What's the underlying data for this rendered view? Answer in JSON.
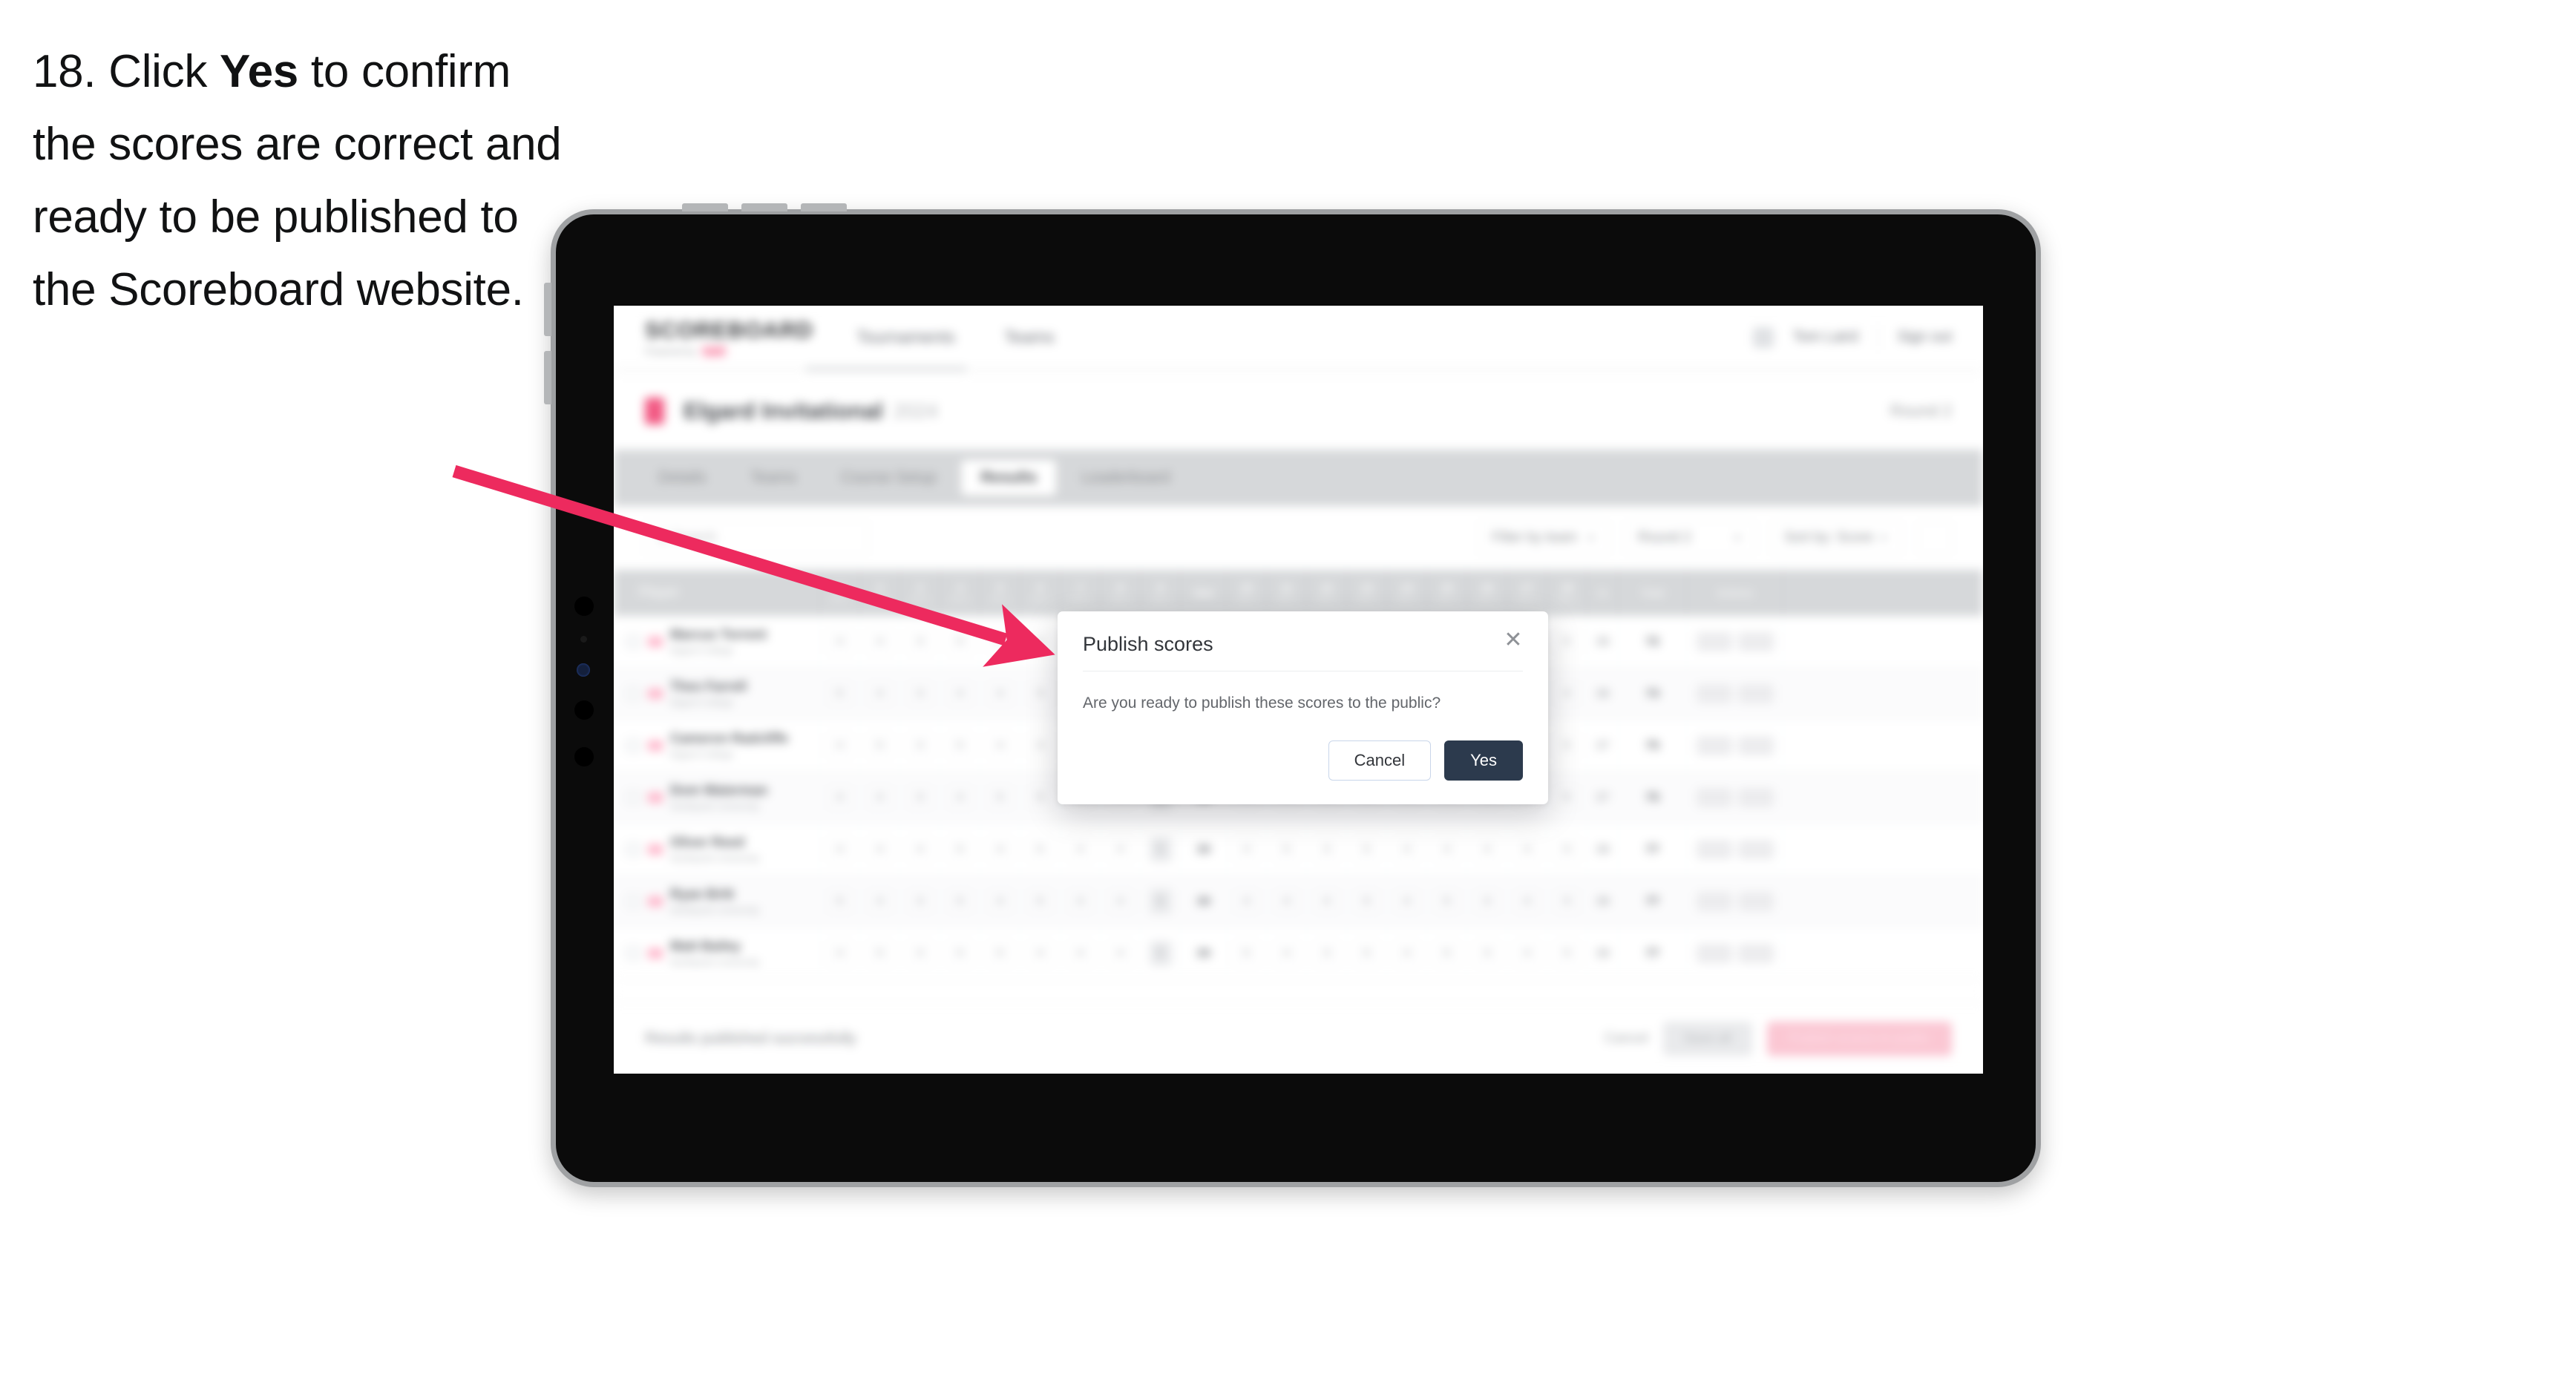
{
  "instruction": {
    "number": "18.",
    "before_bold": "Click ",
    "bold": "Yes",
    "after_bold": " to confirm the scores are correct and ready to be published to the Scoreboard website."
  },
  "colors": {
    "arrow": "#ED2A5E",
    "accent_pink": "#F0386B",
    "primary_dark": "#2C3A4D",
    "tab_bar": "#D6D8DA",
    "publish_button": "#FBC6D3"
  },
  "app": {
    "logo": {
      "main": "SCOREBOARD",
      "sub": "Powered by",
      "sub_accent": "Golf"
    },
    "nav": [
      {
        "label": "Tournaments"
      },
      {
        "label": "Teams"
      }
    ],
    "header_right": {
      "avatar_icon": "user-avatar-icon",
      "user": "Tom Laird",
      "signout": "Sign out"
    },
    "tournament": {
      "flag_icon": "tournament-flag-icon",
      "title": "Elgard Invitational",
      "subtitle": "2024",
      "right_label": "Round 2"
    },
    "tabs": [
      {
        "label": "Details",
        "active": false
      },
      {
        "label": "Teams",
        "active": false
      },
      {
        "label": "Course Setup",
        "active": false
      },
      {
        "label": "Results",
        "active": true
      },
      {
        "label": "Leaderboard",
        "active": false
      }
    ],
    "filters": {
      "search_placeholder": "Search",
      "search_icon": "search-icon",
      "selects": [
        {
          "label": "Filter by team",
          "caret_icon": "chevron-down-icon"
        },
        {
          "label": "Round 2",
          "caret_icon": "chevron-down-icon"
        },
        {
          "label": "Sort by: Score",
          "caret_icon": "chevron-down-icon"
        }
      ],
      "settings_icon": "columns-settings-icon"
    },
    "table": {
      "player_header": "Player",
      "holes": [
        {
          "n": "1",
          "par": "Par 4"
        },
        {
          "n": "2",
          "par": "Par 4"
        },
        {
          "n": "3",
          "par": "Par 3"
        },
        {
          "n": "4",
          "par": "Par 5"
        },
        {
          "n": "5",
          "par": "Par 4"
        },
        {
          "n": "6",
          "par": "Par 4"
        },
        {
          "n": "7",
          "par": "Par 3"
        },
        {
          "n": "8",
          "par": "Par 4"
        },
        {
          "n": "9",
          "par": "Par 5"
        }
      ],
      "out_label": "Out",
      "holes_back": [
        {
          "n": "10",
          "par": "Par 4"
        },
        {
          "n": "11",
          "par": "Par 4"
        },
        {
          "n": "12",
          "par": "Par 3"
        },
        {
          "n": "13",
          "par": "Par 5"
        },
        {
          "n": "14",
          "par": "Par 4"
        },
        {
          "n": "15",
          "par": "Par 4"
        },
        {
          "n": "16",
          "par": "Par 3"
        },
        {
          "n": "17",
          "par": "Par 4"
        },
        {
          "n": "18",
          "par": "Par 5"
        }
      ],
      "in_label": "In",
      "total_label": "Total",
      "action_label": "Actions",
      "rows": [
        {
          "name": "Marcus Torrent",
          "sub": "Elgard College",
          "front": [
            "4",
            "4",
            "3",
            "5",
            "4",
            "4",
            "3",
            "4",
            "5"
          ],
          "out": "36",
          "back": [
            "4",
            "4",
            "3",
            "5",
            "4",
            "4",
            "3",
            "4",
            "5"
          ],
          "in": "36",
          "total": "72"
        },
        {
          "name": "Theo Farrell",
          "sub": "Elgard College",
          "front": [
            "5",
            "4",
            "3",
            "4",
            "4",
            "5",
            "3",
            "4",
            "5"
          ],
          "out": "37",
          "back": [
            "4",
            "5",
            "3",
            "5",
            "4",
            "4",
            "3",
            "4",
            "4"
          ],
          "in": "36",
          "total": "73"
        },
        {
          "name": "Cameron Radcliffe",
          "sub": "Elgard College",
          "front": [
            "4",
            "5",
            "3",
            "5",
            "4",
            "4",
            "4",
            "4",
            "5"
          ],
          "out": "38",
          "back": [
            "4",
            "4",
            "3",
            "5",
            "5",
            "4",
            "3",
            "4",
            "5"
          ],
          "in": "37",
          "total": "75"
        },
        {
          "name": "Dom Waterman",
          "sub": "Northpoint University",
          "front": [
            "4",
            "4",
            "3",
            "4",
            "5",
            "5",
            "4",
            "4",
            "5"
          ],
          "out": "38",
          "back": [
            "5",
            "4",
            "3",
            "5",
            "4",
            "4",
            "3",
            "4",
            "5"
          ],
          "in": "37",
          "total": "75"
        },
        {
          "name": "Oliver Reed",
          "sub": "Northpoint University",
          "front": [
            "4",
            "4",
            "4",
            "5",
            "4",
            "5",
            "4",
            "4",
            "5"
          ],
          "out": "39",
          "back": [
            "4",
            "5",
            "3",
            "5",
            "4",
            "4",
            "4",
            "4",
            "5"
          ],
          "in": "38",
          "total": "77"
        },
        {
          "name": "Ryan Britt",
          "sub": "Northpoint University",
          "front": [
            "5",
            "4",
            "3",
            "5",
            "4",
            "5",
            "4",
            "4",
            "5"
          ],
          "out": "39",
          "back": [
            "4",
            "4",
            "4",
            "5",
            "4",
            "5",
            "3",
            "4",
            "5"
          ],
          "in": "38",
          "total": "77"
        },
        {
          "name": "Matt Bailey",
          "sub": "Northpoint University",
          "front": [
            "4",
            "5",
            "3",
            "5",
            "5",
            "4",
            "4",
            "4",
            "5"
          ],
          "out": "39",
          "back": [
            "5",
            "4",
            "3",
            "5",
            "4",
            "5",
            "3",
            "4",
            "5"
          ],
          "in": "38",
          "total": "77"
        }
      ]
    },
    "bottom_bar": {
      "status": "Results published successfully",
      "link": "Cancel",
      "save_label": "Save all",
      "publish_label": "Publish scores to public"
    }
  },
  "modal": {
    "title": "Publish scores",
    "close_icon": "close-icon",
    "body": "Are you ready to publish these scores to the public?",
    "cancel_label": "Cancel",
    "yes_label": "Yes"
  }
}
